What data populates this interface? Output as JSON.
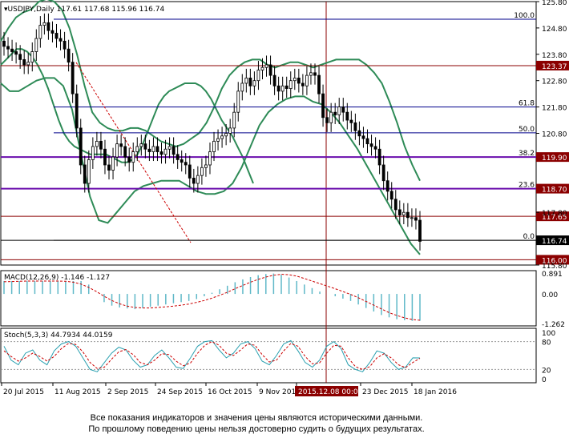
{
  "chart_data": {
    "type": "candlestick",
    "symbol": "USDJPY",
    "timeframe": "Daily",
    "header_ohlc": [
      "117.61",
      "117.68",
      "115.96",
      "116.74"
    ],
    "x_tick_labels": [
      "20 Jul 2015",
      "11 Aug 2015",
      "2 Sep 2015",
      "24 Sep 2015",
      "16 Oct 2015",
      "9 Nov 201",
      "2015.12.08 00:00",
      "23 Dec 2015",
      "18 Jan 2016"
    ],
    "price_axis": {
      "ylim": [
        115.8,
        125.8
      ],
      "ticks": [
        124.8,
        123.8,
        122.8,
        121.8,
        120.8,
        119.8,
        118.8,
        117.8,
        116.8
      ]
    },
    "price_tick_labels": [
      "125.80",
      "124.80",
      "123.80",
      "122.80",
      "121.80",
      "120.80",
      "117.80",
      "115.80"
    ],
    "close_prices": [
      124.1,
      124.0,
      123.9,
      123.8,
      123.6,
      123.4,
      123.5,
      123.9,
      124.4,
      124.9,
      125.0,
      124.7,
      124.6,
      124.4,
      124.3,
      124.0,
      123.5,
      122.3,
      121.0,
      119.6,
      118.9,
      119.8,
      120.3,
      120.5,
      120.2,
      119.6,
      119.4,
      119.9,
      120.4,
      120.3,
      119.9,
      119.7,
      120.1,
      120.3,
      120.4,
      120.2,
      120.1,
      120.3,
      120.1,
      120.0,
      120.2,
      120.3,
      120.0,
      119.8,
      119.7,
      119.6,
      119.1,
      118.9,
      119.2,
      119.5,
      119.6,
      120.1,
      120.5,
      120.6,
      120.7,
      120.8,
      121.0,
      121.6,
      122.4,
      122.7,
      122.9,
      122.6,
      122.8,
      123.2,
      123.3,
      123.4,
      123.0,
      122.6,
      122.4,
      122.6,
      122.5,
      122.8,
      122.9,
      122.7,
      122.6,
      123.0,
      123.1,
      123.0,
      122.3,
      121.4,
      121.2,
      121.6,
      121.5,
      121.8,
      121.6,
      121.3,
      121.2,
      120.9,
      120.7,
      120.6,
      120.4,
      120.3,
      120.2,
      119.6,
      119.0,
      118.6,
      118.3,
      117.9,
      117.7,
      117.8,
      117.6,
      117.6,
      117.5,
      116.7
    ],
    "upper_band": [
      124.3,
      124.8,
      125.2,
      125.4,
      125.5,
      125.8,
      125.9,
      125.8,
      125.5,
      124.8,
      123.8,
      122.6,
      121.6,
      121.2,
      121.0,
      120.9,
      120.9,
      121.0,
      121.0,
      120.9,
      120.7,
      120.5,
      120.4,
      120.3,
      120.4,
      120.6,
      120.8,
      121.2,
      121.8,
      122.5,
      123.0,
      123.3,
      123.5,
      123.6,
      123.6,
      123.4,
      123.3,
      123.4,
      123.5,
      123.5,
      123.4,
      123.3,
      123.4,
      123.5,
      123.6,
      123.6,
      123.6,
      123.6,
      123.4,
      123.1,
      122.7,
      122.0,
      121.2,
      120.3,
      119.6,
      119.0
    ],
    "middle_band": [
      123.4,
      123.6,
      123.8,
      124.0,
      124.0,
      123.9,
      123.7,
      123.4,
      123.0,
      122.5,
      121.9,
      121.3,
      120.8,
      120.5,
      120.3,
      120.2,
      120.1,
      120.0,
      120.0,
      120.0,
      120.0,
      119.9,
      119.8,
      119.7,
      119.7,
      119.8,
      120.0,
      120.4,
      120.9,
      121.4,
      121.9,
      122.2,
      122.4,
      122.5,
      122.6,
      122.7,
      122.7,
      122.7,
      122.6,
      122.4,
      122.1,
      121.7,
      121.3,
      121.0,
      120.7,
      120.3,
      119.9,
      119.4,
      118.9
    ],
    "lower_band": [
      122.7,
      122.4,
      122.4,
      122.6,
      122.8,
      122.9,
      122.9,
      122.6,
      121.7,
      120.0,
      118.4,
      117.5,
      117.4,
      117.8,
      118.2,
      118.6,
      118.8,
      118.9,
      119.0,
      119.0,
      119.0,
      118.8,
      118.6,
      118.5,
      118.5,
      118.6,
      118.9,
      119.5,
      120.3,
      121.1,
      121.6,
      121.9,
      122.1,
      122.2,
      122.2,
      122.0,
      121.9,
      121.6,
      121.2,
      120.7,
      120.2,
      119.6,
      119.0,
      118.4,
      117.8,
      117.2,
      116.6,
      116.2
    ],
    "horizontal_levels": [
      {
        "price": 123.37,
        "label": "123.37",
        "color": "#8b0000"
      },
      {
        "price": 119.9,
        "label": "119.90",
        "color": "#8b0000"
      },
      {
        "price": 118.7,
        "label": "118.70",
        "color": "#8b0000"
      },
      {
        "price": 117.65,
        "label": "117.65",
        "color": "#8b0000"
      },
      {
        "price": 116.74,
        "label": "116.74",
        "color": "#000000"
      },
      {
        "price": 116.0,
        "label": "116.00",
        "color": "#8b0000"
      }
    ],
    "fibonacci_levels": [
      {
        "ratio": "100.0",
        "price": 125.13
      },
      {
        "ratio": "61.8",
        "price": 121.8
      },
      {
        "ratio": "50.0",
        "price": 120.82
      },
      {
        "ratio": "38.2",
        "price": 119.9
      },
      {
        "ratio": "23.6",
        "price": 118.7
      },
      {
        "ratio": "0.0",
        "price": 116.74
      }
    ],
    "macd": {
      "label": "MACD(12,26,9) -1.146 -1.127",
      "axis_ticks": [
        "0.891",
        "0.00",
        "-1.262"
      ],
      "histogram": [
        0.55,
        0.55,
        0.55,
        0.55,
        0.55,
        0.55,
        0.55,
        0.55,
        0.55,
        0.55,
        0.55,
        0.4,
        0.0,
        -0.35,
        -0.5,
        -0.58,
        -0.62,
        -0.65,
        -0.6,
        -0.55,
        -0.5,
        -0.45,
        -0.4,
        -0.35,
        -0.3,
        -0.22,
        -0.1,
        0.05,
        0.2,
        0.35,
        0.5,
        0.62,
        0.72,
        0.8,
        0.85,
        0.87,
        0.82,
        0.7,
        0.55,
        0.4,
        0.25,
        0.1,
        0.0,
        -0.1,
        -0.2,
        -0.3,
        -0.45,
        -0.6,
        -0.75,
        -0.9,
        -1.0,
        -1.08,
        -1.12,
        -1.15,
        -1.146
      ],
      "signal": [
        0.52,
        0.53,
        0.54,
        0.55,
        0.55,
        0.55,
        0.55,
        0.55,
        0.54,
        0.5,
        0.42,
        0.28,
        0.1,
        -0.1,
        -0.28,
        -0.42,
        -0.52,
        -0.58,
        -0.6,
        -0.6,
        -0.58,
        -0.55,
        -0.52,
        -0.48,
        -0.43,
        -0.36,
        -0.28,
        -0.18,
        -0.06,
        0.07,
        0.22,
        0.36,
        0.5,
        0.62,
        0.72,
        0.8,
        0.84,
        0.82,
        0.76,
        0.66,
        0.55,
        0.44,
        0.33,
        0.22,
        0.1,
        -0.02,
        -0.16,
        -0.32,
        -0.48,
        -0.64,
        -0.8,
        -0.92,
        -1.02,
        -1.09,
        -1.127
      ]
    },
    "stochastic": {
      "label": "Stoch(5,3,3) 44.7934 44.0159",
      "axis_ticks": [
        "100",
        "80",
        "20",
        "0"
      ],
      "main": [
        70,
        40,
        30,
        55,
        62,
        40,
        30,
        60,
        75,
        80,
        70,
        45,
        20,
        15,
        35,
        55,
        68,
        62,
        40,
        25,
        30,
        50,
        62,
        45,
        25,
        22,
        45,
        70,
        80,
        82,
        62,
        45,
        55,
        75,
        80,
        65,
        38,
        30,
        50,
        75,
        82,
        60,
        35,
        25,
        40,
        70,
        80,
        65,
        30,
        20,
        15,
        35,
        60,
        55,
        35,
        20,
        25,
        45,
        44.8
      ],
      "signal": [
        60,
        48,
        38,
        45,
        55,
        48,
        38,
        48,
        65,
        76,
        74,
        58,
        35,
        22,
        25,
        42,
        58,
        63,
        52,
        35,
        30,
        40,
        54,
        52,
        38,
        28,
        34,
        55,
        72,
        80,
        72,
        55,
        50,
        62,
        75,
        72,
        52,
        36,
        40,
        60,
        76,
        70,
        48,
        32,
        34,
        55,
        72,
        70,
        45,
        26,
        20,
        26,
        45,
        54,
        45,
        30,
        24,
        35,
        44.0
      ]
    }
  },
  "disclaimer": [
    "Все показания индикаторов и значения цены являются историческими данными.",
    "По прошлому поведению цены нельзя достоверно судить о будущих результатах."
  ]
}
